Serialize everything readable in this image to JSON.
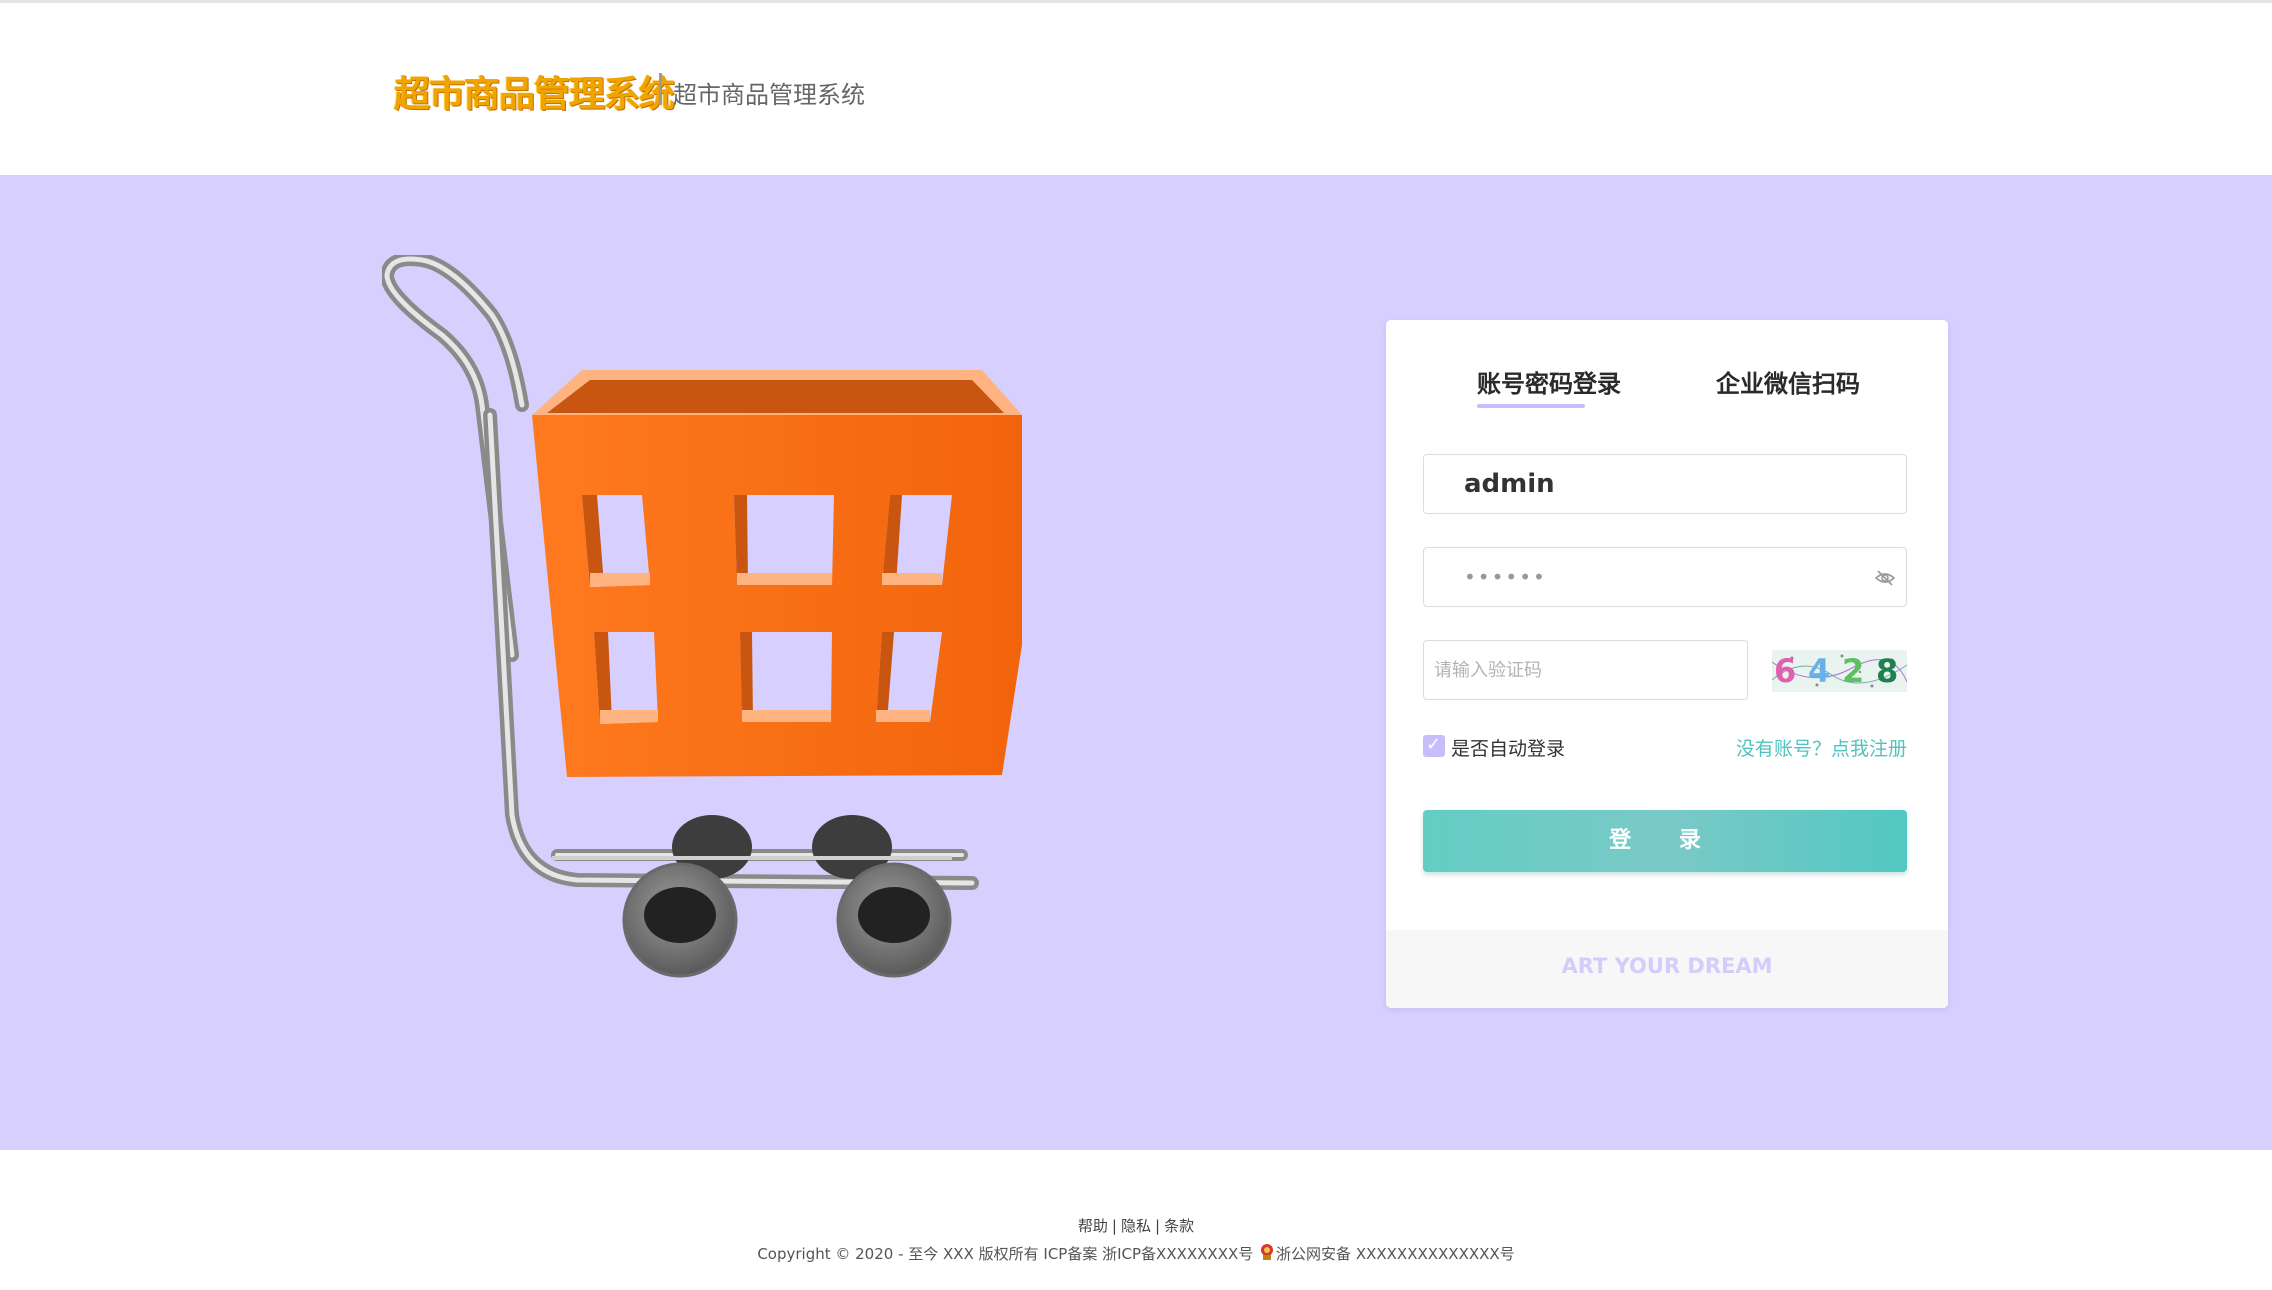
{
  "header": {
    "logo_text": "超市商品管理系统",
    "subtitle": "超市商品管理系统"
  },
  "hero": {
    "image": "shopping-cart-illustration"
  },
  "login": {
    "tabs": [
      {
        "label": "账号密码登录",
        "active": true
      },
      {
        "label": "企业微信扫码",
        "active": false
      }
    ],
    "username_value": "admin",
    "password_value": "••••••",
    "captcha_placeholder": "请输入验证码",
    "captcha_code": [
      "6",
      "4",
      "2",
      "8"
    ],
    "remember_label": "是否自动登录",
    "remember_checked": true,
    "register_link": "没有账号？点我注册",
    "login_button": "登 录",
    "slogan": "ART YOUR DREAM"
  },
  "footer": {
    "links": [
      "帮助",
      "隐私",
      "条款"
    ],
    "copyright": "Copyright © 2020 - 至今 XXX 版权所有 ICP备案 浙ICP备XXXXXXXX号",
    "police_record": "浙公网安备 XXXXXXXXXXXXXX号"
  },
  "colors": {
    "hero_bg": "#d7cffd",
    "accent": "#c8bdfb",
    "button": "#63cdc4",
    "link": "#4fc4be",
    "logo": "#f0a400"
  },
  "icons": [
    "eye-off-icon",
    "checkbox-check-icon",
    "police-badge-icon"
  ]
}
